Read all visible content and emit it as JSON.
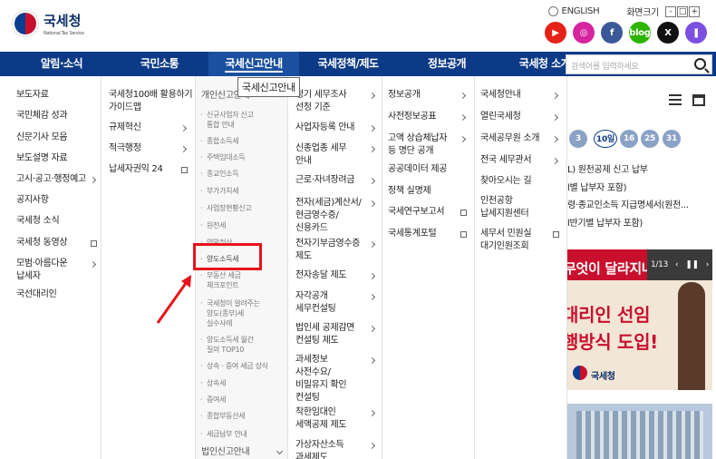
{
  "brand": {
    "title": "국세청",
    "subtitle": "National Tax Service"
  },
  "util": {
    "lang": "ENGLISH",
    "zoom": "화면크기",
    "zoom_minus": "-",
    "zoom_reset": "□",
    "zoom_plus": "+"
  },
  "sns": [
    {
      "name": "youtube",
      "label": "▶",
      "color": "#e62117"
    },
    {
      "name": "instagram",
      "label": "◎",
      "color": "#d6249f"
    },
    {
      "name": "facebook",
      "label": "f",
      "color": "#3b5998"
    },
    {
      "name": "blog",
      "label": "blog",
      "color": "#2db400"
    },
    {
      "name": "x",
      "label": "X",
      "color": "#111111"
    },
    {
      "name": "kakao",
      "label": "❚",
      "color": "#7b4fe0"
    }
  ],
  "nav": [
    "알림·소식",
    "국민소통",
    "국세신고안내",
    "국세정책/제도",
    "정보공개",
    "국세청 소개"
  ],
  "search": {
    "placeholder": "검색어를 입력하세요"
  },
  "tooltip": "국세신고안내",
  "col1": [
    "보도자료",
    "국민체감 성과",
    "신문기사 모음",
    "보도설명 자료",
    "고시·공고·행정예고",
    "공지사항",
    "국세청 소식",
    "국세청 동영상",
    "모범·아름다운\n납세자",
    "국선대리인"
  ],
  "col2": [
    "국세청100배 활용하기\n가이드맵",
    "규제혁신",
    "적극행정",
    "납세자권익 24"
  ],
  "col3": {
    "header": "개인신고안내",
    "subs": [
      "신규사업자 신고\n통합 안내",
      "종합소득세",
      "주택임대소득",
      "종교인소득",
      "부가가치세",
      "사업장현황신고",
      "원천세",
      "연말정산",
      "양도소득세",
      "부동산 세금\n체크포인트",
      "국세청이 알려주는\n양도(종부)세\n실수사례",
      "양도소득세 월간\n질의 TOP10",
      "상속 · 증여 세금 상식",
      "상속세",
      "증여세",
      "종합부동산세",
      "세금납부 안내"
    ],
    "footer": "법인신고안내"
  },
  "col4": [
    "정기 세무조사\n선정 기준",
    "사업자등록 안내",
    "신종업종 세무\n안내",
    "근로·자녀장려금",
    "전자(세금)계산서/\n현금영수증/\n신용카드",
    "전자기부금영수증\n제도",
    "전자송달 제도",
    "자각공개\n세무컨설팅",
    "법인세 공제감면\n컨설팅 제도",
    "과세정보\n사전수요/\n비밀유지 확인\n컨설팅",
    "착한임대인\n세액공제 제도",
    "가상자산소득\n과세제도"
  ],
  "col5": [
    "정보공개",
    "사전정보공표",
    "고액 상습체납자\n등 명단 공개",
    "공공데이터 제공",
    "정책 실명제",
    "국세연구보고서",
    "국세통계포털"
  ],
  "col6": [
    "국세청안내",
    "열린국세청",
    "국세공무원 소개",
    "전국 세무관서",
    "찾아오시는 길",
    "인천공항\n납세지원센터",
    "세무서 민원실\n대기인원조회"
  ],
  "right": {
    "dates": [
      "3",
      "10일",
      "16",
      "25",
      "31"
    ],
    "lines": [
      "L) 원천공제 신고 납부",
      "l별 납부자 포함)",
      "령·종교인소득 지급명세서(원천...",
      "l반기별 납부자 포함)"
    ],
    "banner_counter": "1/13",
    "banner_text1": "무엇이 달라지나",
    "banner_text2": "대리인 선임",
    "banner_text3": "행방식 도입!",
    "banner_brand": "국세청"
  }
}
